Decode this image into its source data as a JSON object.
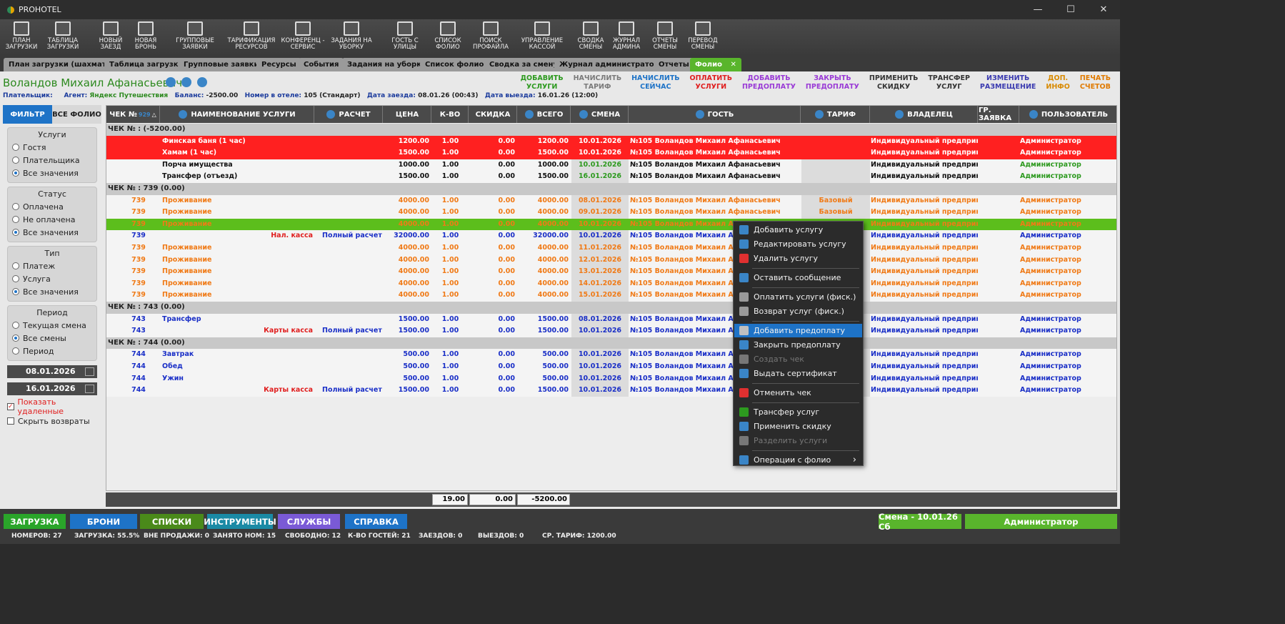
{
  "window": {
    "title": "PROHOTEL"
  },
  "toolbar": [
    {
      "label": "ПЛАН\nЗАГРУЗКИ",
      "icon": "plan-icon"
    },
    {
      "label": "ТАБЛИЦА\nЗАГРУЗКИ",
      "icon": "table-icon"
    },
    {
      "label": "НОВЫЙ\nЗАЕЗД",
      "icon": "new-checkin-icon"
    },
    {
      "label": "НОВАЯ\nБРОНЬ",
      "icon": "new-booking-icon"
    },
    {
      "label": "ГРУППОВЫЕ\nЗАЯВКИ",
      "icon": "group-icon"
    },
    {
      "label": "ТАРИФИКАЦИЯ\nРЕСУРСОВ",
      "icon": "tariff-icon"
    },
    {
      "label": "КОНФЕРЕНЦ -\nСЕРВИС",
      "icon": "conference-icon"
    },
    {
      "label": "ЗАДАНИЯ НА\nУБОРКУ",
      "icon": "cleaning-icon"
    },
    {
      "label": "ГОСТЬ С\nУЛИЦЫ",
      "icon": "walkin-icon"
    },
    {
      "label": "СПИСОК\nФОЛИО",
      "icon": "folio-list-icon"
    },
    {
      "label": "ПОИСК\nПРОФАЙЛА",
      "icon": "profile-search-icon"
    },
    {
      "label": "УПРАВЛЕНИЕ\nКАССОЙ",
      "icon": "cashbox-icon"
    },
    {
      "label": "СВОДКА\nСМЕНЫ",
      "icon": "shift-summary-icon"
    },
    {
      "label": "ЖУРНАЛ\nАДМИНА",
      "icon": "admin-log-icon"
    },
    {
      "label": "ОТЧЕТЫ\nСМЕНЫ",
      "icon": "shift-reports-icon"
    },
    {
      "label": "ПЕРЕВОД\nСМЕНЫ",
      "icon": "shift-transfer-icon"
    }
  ],
  "tabs": [
    "План загрузки (шахматка)",
    "Таблица загрузки",
    "Групповые заявки",
    "Ресурсы",
    "События",
    "Задания на уборку",
    "Список фолио",
    "Сводка за смену",
    "Журнал администратора",
    "Отчеты",
    "Фолио"
  ],
  "guest": {
    "name": "Воландов Михаил Афанасьевич"
  },
  "actions": [
    {
      "label": "ДОБАВИТЬ\nУСЛУГИ",
      "color": "#2d9a1f"
    },
    {
      "label": "НАЧИСЛИТЬ\nТАРИФ",
      "color": "#7a7a7a"
    },
    {
      "label": "НАЧИСЛИТЬ\nСЕЙЧАС",
      "color": "#1e73c7"
    },
    {
      "label": "ОПЛАТИТЬ\nУСЛУГИ",
      "color": "#e01e1e"
    },
    {
      "label": "ДОБАВИТЬ\nПРЕДОПЛАТУ",
      "color": "#9a3ad6"
    },
    {
      "label": "ЗАКРЫТЬ\nПРЕДОПЛАТУ",
      "color": "#9a3ad6"
    },
    {
      "label": "ПРИМЕНИТЬ\nСКИДКУ",
      "color": "#333333"
    },
    {
      "label": "ТРАНСФЕР\nУСЛУГ",
      "color": "#333333"
    },
    {
      "label": "ИЗМЕНИТЬ\nРАЗМЕЩЕНИЕ",
      "color": "#3a3ab0"
    },
    {
      "label": "ДОП.\nИНФО",
      "color": "#d88a00"
    },
    {
      "label": "ПЕЧАТЬ\nСЧЕТОВ",
      "color": "#e07a00"
    }
  ],
  "info": {
    "payer_label": "Плательщик:",
    "agent_label": "Агент:",
    "agent": "Яндекс Путешествия",
    "balance_label": "Баланс:",
    "balance": "-2500.00",
    "room_label": "Номер в отеле:",
    "room": "105 (Стандарт)",
    "arrival_label": "Дата заезда:",
    "arrival": "08.01.26 (00:43)",
    "departure_label": "Дата выезда:",
    "departure": "16.01.26 (12:00)"
  },
  "sidebar": {
    "tab_filter": "ФИЛЬТР",
    "tab_all": "ВСЕ ФОЛИО",
    "groups": [
      {
        "title": "Услуги",
        "options": [
          "Гостя",
          "Плательщика",
          "Все значения"
        ],
        "selected": 2
      },
      {
        "title": "Статус",
        "options": [
          "Оплачена",
          "Не оплачена",
          "Все значения"
        ],
        "selected": 2
      },
      {
        "title": "Тип",
        "options": [
          "Платеж",
          "Услуга",
          "Все значения"
        ],
        "selected": 2
      },
      {
        "title": "Период",
        "options": [
          "Текущая смена",
          "Все смены",
          "Период"
        ],
        "selected": 1
      }
    ],
    "date_from": "08.01.2026",
    "date_to": "16.01.2026",
    "show_deleted": "Показать удаленные",
    "hide_returns": "Скрыть возвраты"
  },
  "columns": [
    "ЧЕК №",
    "НАИМЕНОВАНИЕ УСЛУГИ",
    "РАСЧЕТ",
    "ЦЕНА",
    "К-ВО",
    "СКИДКА",
    "ВСЕГО",
    "СМЕНА",
    "ГОСТЬ",
    "ТАРИФ",
    "ВЛАДЕЛЕЦ",
    "ГР. ЗАЯВКА",
    "ПОЛЬЗОВАТЕЛЬ"
  ],
  "chk_sort": "929",
  "rows": [
    {
      "kind": "group",
      "text": "ЧЕК № :  (-5200.00)"
    },
    {
      "kind": "red",
      "chk": "",
      "name": "Финская баня (1 час)",
      "pay": "",
      "calc": "",
      "price": "1200.00",
      "qty": "1.00",
      "disc": "0.00",
      "total": "1200.00",
      "shift": "10.01.2026",
      "guest": "№105 Воландов Михаил Афанасьевич",
      "tariff": "",
      "owner": "Индивидуальный предприн...",
      "user": "Администратор"
    },
    {
      "kind": "red",
      "chk": "",
      "name": "Хамам (1 час)",
      "pay": "",
      "calc": "",
      "price": "1500.00",
      "qty": "1.00",
      "disc": "0.00",
      "total": "1500.00",
      "shift": "10.01.2026",
      "guest": "№105 Воландов Михаил Афанасьевич",
      "tariff": "",
      "owner": "Индивидуальный предприн...",
      "user": "Администратор"
    },
    {
      "kind": "white",
      "chk": "",
      "name": "Порча имущества",
      "pay": "",
      "calc": "",
      "price": "1000.00",
      "qty": "1.00",
      "disc": "0.00",
      "total": "1000.00",
      "shift": "10.01.2026",
      "guest": "№105 Воландов Михаил Афанасьевич",
      "tariff": "",
      "owner": "Индивидуальный предприн...",
      "user": "Администратор"
    },
    {
      "kind": "white",
      "chk": "",
      "name": "Трансфер (отъезд)",
      "pay": "",
      "calc": "",
      "price": "1500.00",
      "qty": "1.00",
      "disc": "0.00",
      "total": "1500.00",
      "shift": "16.01.2026",
      "guest": "№105 Воландов Михаил Афанасьевич",
      "tariff": "",
      "owner": "Индивидуальный предприн...",
      "user": "Администратор"
    },
    {
      "kind": "group",
      "text": "ЧЕК № : 739 (0.00)"
    },
    {
      "kind": "orange",
      "chk": "739",
      "name": "Проживание",
      "pay": "",
      "calc": "",
      "price": "4000.00",
      "qty": "1.00",
      "disc": "0.00",
      "total": "4000.00",
      "shift": "08.01.2026",
      "guest": "№105 Воландов Михаил Афанасьевич",
      "tariff": "Базовый",
      "owner": "Индивидуальный предприн...",
      "user": "Администратор"
    },
    {
      "kind": "orange",
      "chk": "739",
      "name": "Проживание",
      "pay": "",
      "calc": "",
      "price": "4000.00",
      "qty": "1.00",
      "disc": "0.00",
      "total": "4000.00",
      "shift": "09.01.2026",
      "guest": "№105 Воландов Михаил Афанасьевич",
      "tariff": "Базовый",
      "owner": "Индивидуальный предприн...",
      "user": "Администратор"
    },
    {
      "kind": "green",
      "chk": "739",
      "name": "Проживание",
      "pay": "",
      "calc": "",
      "price": "4000.00",
      "qty": "1.00",
      "disc": "0.00",
      "total": "4000.00",
      "shift": "10.01.2026",
      "guest": "№105 Воландов Михаил Афанасьевич",
      "tariff": "",
      "owner": "Индивидуальный предприн...",
      "user": "Администратор"
    },
    {
      "kind": "blue",
      "chk": "739",
      "name": "",
      "pay": "Нал. касса",
      "calc": "Полный расчет",
      "price": "32000.00",
      "qty": "1.00",
      "disc": "0.00",
      "total": "32000.00",
      "shift": "10.01.2026",
      "guest": "№105 Воландов Михаил Афанасьевич",
      "tariff": "",
      "owner": "Индивидуальный предприн...",
      "user": "Администратор"
    },
    {
      "kind": "orange",
      "chk": "739",
      "name": "Проживание",
      "pay": "",
      "calc": "",
      "price": "4000.00",
      "qty": "1.00",
      "disc": "0.00",
      "total": "4000.00",
      "shift": "11.01.2026",
      "guest": "№105 Воландов Михаил Афанасьевич",
      "tariff": "",
      "owner": "Индивидуальный предприн...",
      "user": "Администратор"
    },
    {
      "kind": "orange",
      "chk": "739",
      "name": "Проживание",
      "pay": "",
      "calc": "",
      "price": "4000.00",
      "qty": "1.00",
      "disc": "0.00",
      "total": "4000.00",
      "shift": "12.01.2026",
      "guest": "№105 Воландов Михаил Афанасьевич",
      "tariff": "",
      "owner": "Индивидуальный предприн...",
      "user": "Администратор"
    },
    {
      "kind": "orange",
      "chk": "739",
      "name": "Проживание",
      "pay": "",
      "calc": "",
      "price": "4000.00",
      "qty": "1.00",
      "disc": "0.00",
      "total": "4000.00",
      "shift": "13.01.2026",
      "guest": "№105 Воландов Михаил Афанасьевич",
      "tariff": "",
      "owner": "Индивидуальный предприн...",
      "user": "Администратор"
    },
    {
      "kind": "orange",
      "chk": "739",
      "name": "Проживание",
      "pay": "",
      "calc": "",
      "price": "4000.00",
      "qty": "1.00",
      "disc": "0.00",
      "total": "4000.00",
      "shift": "14.01.2026",
      "guest": "№105 Воландов Михаил Афанасьевич",
      "tariff": "",
      "owner": "Индивидуальный предприн...",
      "user": "Администратор"
    },
    {
      "kind": "orange",
      "chk": "739",
      "name": "Проживание",
      "pay": "",
      "calc": "",
      "price": "4000.00",
      "qty": "1.00",
      "disc": "0.00",
      "total": "4000.00",
      "shift": "15.01.2026",
      "guest": "№105 Воландов Михаил Афанасьевич",
      "tariff": "",
      "owner": "Индивидуальный предприн...",
      "user": "Администратор"
    },
    {
      "kind": "group",
      "text": "ЧЕК № : 743 (0.00)"
    },
    {
      "kind": "blue",
      "chk": "743",
      "name": "Трансфер",
      "pay": "",
      "calc": "",
      "price": "1500.00",
      "qty": "1.00",
      "disc": "0.00",
      "total": "1500.00",
      "shift": "08.01.2026",
      "guest": "№105 Воландов Михаил Афанасьевич",
      "tariff": "",
      "owner": "Индивидуальный предприн...",
      "user": "Администратор"
    },
    {
      "kind": "blue",
      "chk": "743",
      "name": "",
      "pay": "Карты касса",
      "calc": "Полный расчет",
      "price": "1500.00",
      "qty": "1.00",
      "disc": "0.00",
      "total": "1500.00",
      "shift": "10.01.2026",
      "guest": "№105 Воландов Михаил Афанасьевич",
      "tariff": "",
      "owner": "Индивидуальный предприн...",
      "user": "Администратор"
    },
    {
      "kind": "group",
      "text": "ЧЕК № : 744 (0.00)"
    },
    {
      "kind": "blue",
      "chk": "744",
      "name": "Завтрак",
      "pay": "",
      "calc": "",
      "price": "500.00",
      "qty": "1.00",
      "disc": "0.00",
      "total": "500.00",
      "shift": "10.01.2026",
      "guest": "№105 Воландов Михаил Афанасьевич",
      "tariff": "",
      "owner": "Индивидуальный предприн...",
      "user": "Администратор"
    },
    {
      "kind": "blue",
      "chk": "744",
      "name": "Обед",
      "pay": "",
      "calc": "",
      "price": "500.00",
      "qty": "1.00",
      "disc": "0.00",
      "total": "500.00",
      "shift": "10.01.2026",
      "guest": "№105 Воландов Михаил Афанасьевич",
      "tariff": "",
      "owner": "Индивидуальный предприн...",
      "user": "Администратор"
    },
    {
      "kind": "blue",
      "chk": "744",
      "name": "Ужин",
      "pay": "",
      "calc": "",
      "price": "500.00",
      "qty": "1.00",
      "disc": "0.00",
      "total": "500.00",
      "shift": "10.01.2026",
      "guest": "№105 Воландов Михаил Афанасьевич",
      "tariff": "",
      "owner": "Индивидуальный предприн...",
      "user": "Администратор"
    },
    {
      "kind": "blue",
      "chk": "744",
      "name": "",
      "pay": "Карты касса",
      "calc": "Полный расчет",
      "price": "1500.00",
      "qty": "1.00",
      "disc": "0.00",
      "total": "1500.00",
      "shift": "10.01.2026",
      "guest": "№105 Воландов Михаил Афанасьевич",
      "tariff": "",
      "owner": "Индивидуальный предприн...",
      "user": "Администратор"
    }
  ],
  "totals": {
    "qty": "19.00",
    "disc": "0.00",
    "total": "-5200.00"
  },
  "context_menu": [
    {
      "label": "Добавить услугу",
      "icon": "plus-icon",
      "color": "#3a85c7"
    },
    {
      "label": "Редактировать услугу",
      "icon": "pencil-icon",
      "color": "#3a85c7"
    },
    {
      "label": "Удалить услугу",
      "icon": "delete-x-icon",
      "color": "#e03030"
    },
    {
      "sep": true
    },
    {
      "label": "Оставить сообщение",
      "icon": "message-icon",
      "color": "#3a85c7"
    },
    {
      "sep": true
    },
    {
      "label": "Оплатить услуги (фиск.)",
      "icon": "printer-icon",
      "color": "#9a9a9a"
    },
    {
      "label": "Возврат услуг (фиск.)",
      "icon": "printer-return-icon",
      "color": "#9a9a9a"
    },
    {
      "sep": true
    },
    {
      "label": "Добавить предоплату",
      "icon": "card-icon",
      "color": "#c0c0c0",
      "highlight": true
    },
    {
      "label": "Закрыть предоплату",
      "icon": "checkbox-icon",
      "color": "#3a85c7"
    },
    {
      "label": "Создать чек",
      "icon": "receipt-icon",
      "color": "#777777",
      "disabled": true
    },
    {
      "label": "Выдать сертификат",
      "icon": "star-icon",
      "color": "#3a85c7"
    },
    {
      "sep": true
    },
    {
      "label": "Отменить чек",
      "icon": "cancel-receipt-icon",
      "color": "#e03030"
    },
    {
      "sep": true
    },
    {
      "label": "Трансфер услуг",
      "icon": "transfer-icon",
      "color": "#2d9a1f"
    },
    {
      "label": "Применить скидку",
      "icon": "discount-icon",
      "color": "#3a85c7"
    },
    {
      "label": "Разделить услуги",
      "icon": "split-icon",
      "color": "#777777",
      "disabled": true
    },
    {
      "sep": true
    },
    {
      "label": "Операции с фолио",
      "icon": "folio-ops-icon",
      "color": "#3a85c7",
      "submenu": true
    }
  ],
  "bottom_buttons": [
    {
      "label": "ЗАГРУЗКА",
      "color": "#2aa52a"
    },
    {
      "label": "БРОНИ",
      "color": "#1e73c7"
    },
    {
      "label": "СПИСКИ",
      "color": "#4a8a1a"
    },
    {
      "label": "ИНСТРУМЕНТЫ",
      "color": "#1a8aa5"
    },
    {
      "label": "СЛУЖБЫ",
      "color": "#7a5ad6"
    },
    {
      "label": "СПРАВКА",
      "color": "#1e73c7"
    }
  ],
  "shift_label": "Смена - 10.01.26  Сб",
  "user_label": "Администратор",
  "statusbar": [
    "НОМЕРОВ: 27",
    "ЗАГРУЗКА: 55.5%",
    "ВНЕ ПРОДАЖИ: 0",
    "ЗАНЯТО НОМ: 15",
    "СВОБОДНО: 12",
    "К-ВО ГОСТЕЙ: 21",
    "ЗАЕЗДОВ: 0",
    "ВЫЕЗДОВ: 0",
    "СР. ТАРИФ: 1200.00"
  ]
}
